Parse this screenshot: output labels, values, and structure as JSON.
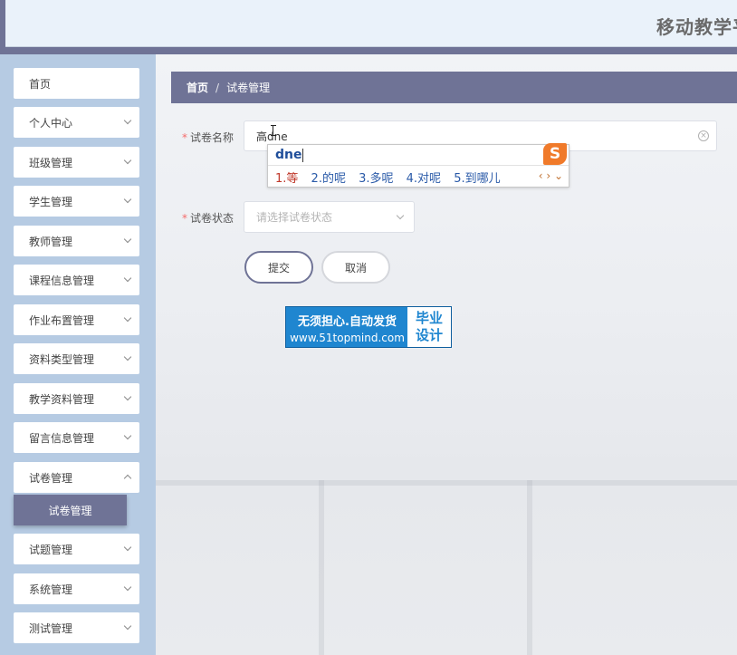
{
  "header": {
    "title": "移动教学平"
  },
  "sidebar": {
    "items": [
      {
        "label": "首页",
        "has_children": false
      },
      {
        "label": "个人中心",
        "has_children": true
      },
      {
        "label": "班级管理",
        "has_children": true
      },
      {
        "label": "学生管理",
        "has_children": true
      },
      {
        "label": "教师管理",
        "has_children": true
      },
      {
        "label": "课程信息管理",
        "has_children": true
      },
      {
        "label": "作业布置管理",
        "has_children": true
      },
      {
        "label": "资料类型管理",
        "has_children": true
      },
      {
        "label": "教学资料管理",
        "has_children": true
      },
      {
        "label": "留言信息管理",
        "has_children": true
      },
      {
        "label": "试卷管理",
        "has_children": true,
        "expanded": true
      },
      {
        "label": "试题管理",
        "has_children": true
      },
      {
        "label": "系统管理",
        "has_children": true
      },
      {
        "label": "测试管理",
        "has_children": true
      }
    ],
    "active_sub": "试卷管理"
  },
  "breadcrumb": {
    "home": "首页",
    "separator": "/",
    "current": "试卷管理"
  },
  "form": {
    "name_label": "试卷名称",
    "name_value": "高dne",
    "status_label": "试卷状态",
    "status_placeholder": "请选择试卷状态",
    "submit_label": "提交",
    "cancel_label": "取消",
    "required_mark": "*",
    "clear_glyph": "×"
  },
  "ime": {
    "composition": "dne",
    "logo": "S",
    "candidates": [
      "1.等",
      "2.的呢",
      "3.多呢",
      "4.对呢",
      "5.到哪儿"
    ],
    "nav": "‹ › ⌄"
  },
  "watermark": {
    "line1": "无须担心.自动发货",
    "line2": "www.51topmind.com",
    "right1": "毕业",
    "right2": "设计"
  }
}
